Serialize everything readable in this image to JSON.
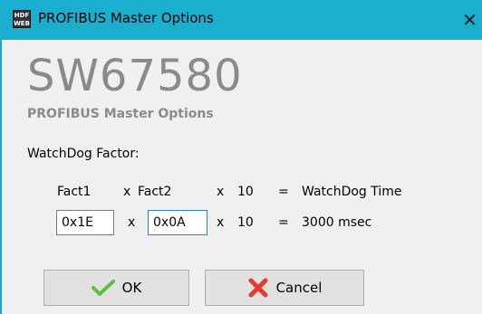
{
  "window": {
    "title": "PROFIBUS Master Options",
    "app_icon_top": "HDF",
    "app_icon_bottom": "WEB",
    "close_glyph": "✕"
  },
  "header": {
    "product_code": "SW67580",
    "subtitle": "PROFIBUS Master Options"
  },
  "watchdog": {
    "section_label": "WatchDog Factor:",
    "formula": {
      "fact1": "Fact1",
      "times1": "x",
      "fact2": "Fact2",
      "times2": "x",
      "multiplier": "10",
      "equals": "=",
      "result_label": "WatchDog Time"
    },
    "fact1_value": "0x1E",
    "fact2_value": "0x0A",
    "times_a": "x",
    "times_b": "x",
    "multiplier": "10",
    "equals": "=",
    "result_value": "3000 msec"
  },
  "buttons": {
    "ok_label": "OK",
    "cancel_label": "Cancel"
  },
  "colors": {
    "titlebar": "#1aaecf",
    "logo_gray": "#8a8a8a",
    "ok_check": "#5cc043",
    "cancel_x": "#e23b2e"
  },
  "icons": {
    "ok": "checkmark-icon",
    "cancel": "red-x-icon",
    "close": "close-icon"
  }
}
